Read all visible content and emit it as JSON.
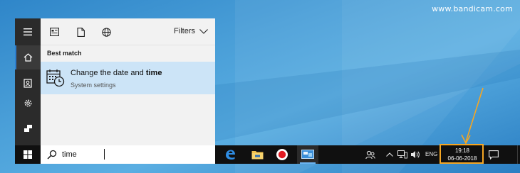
{
  "watermark": "www.bandicam.com",
  "start_menu": {
    "rail": {
      "menu_icon": "hamburger-icon",
      "home_icon": "home-icon",
      "documents_icon": "documents-icon",
      "settings_icon": "gear-icon",
      "feedback_icon": "feedback-icon"
    },
    "toolbar": {
      "apps_icon": "apps-icon",
      "documents_icon": "document-icon",
      "web_icon": "globe-icon",
      "filters_label": "Filters"
    },
    "section_label": "Best match",
    "best_match": {
      "title_prefix": "Change the date and ",
      "title_highlight": "time",
      "subtitle": "System settings",
      "icon": "calendar-clock-icon"
    }
  },
  "taskbar": {
    "search": {
      "value": "time",
      "icon": "search-icon"
    },
    "apps": [
      "edge-icon",
      "file-explorer-icon",
      "record-icon",
      "control-panel-icon"
    ],
    "tray": {
      "people_icon": "people-icon",
      "chevron_icon": "chevron-up-icon",
      "network_icon": "network-icon",
      "volume_icon": "volume-icon",
      "language": "ENG"
    },
    "clock": {
      "time": "19:18",
      "date": "06-06-2018"
    },
    "notification_icon": "action-center-icon"
  },
  "colors": {
    "accent": "#2d7fd1",
    "highlight_box": "#f5a623",
    "selection": "#cce4f7",
    "taskbar": "#101010"
  }
}
